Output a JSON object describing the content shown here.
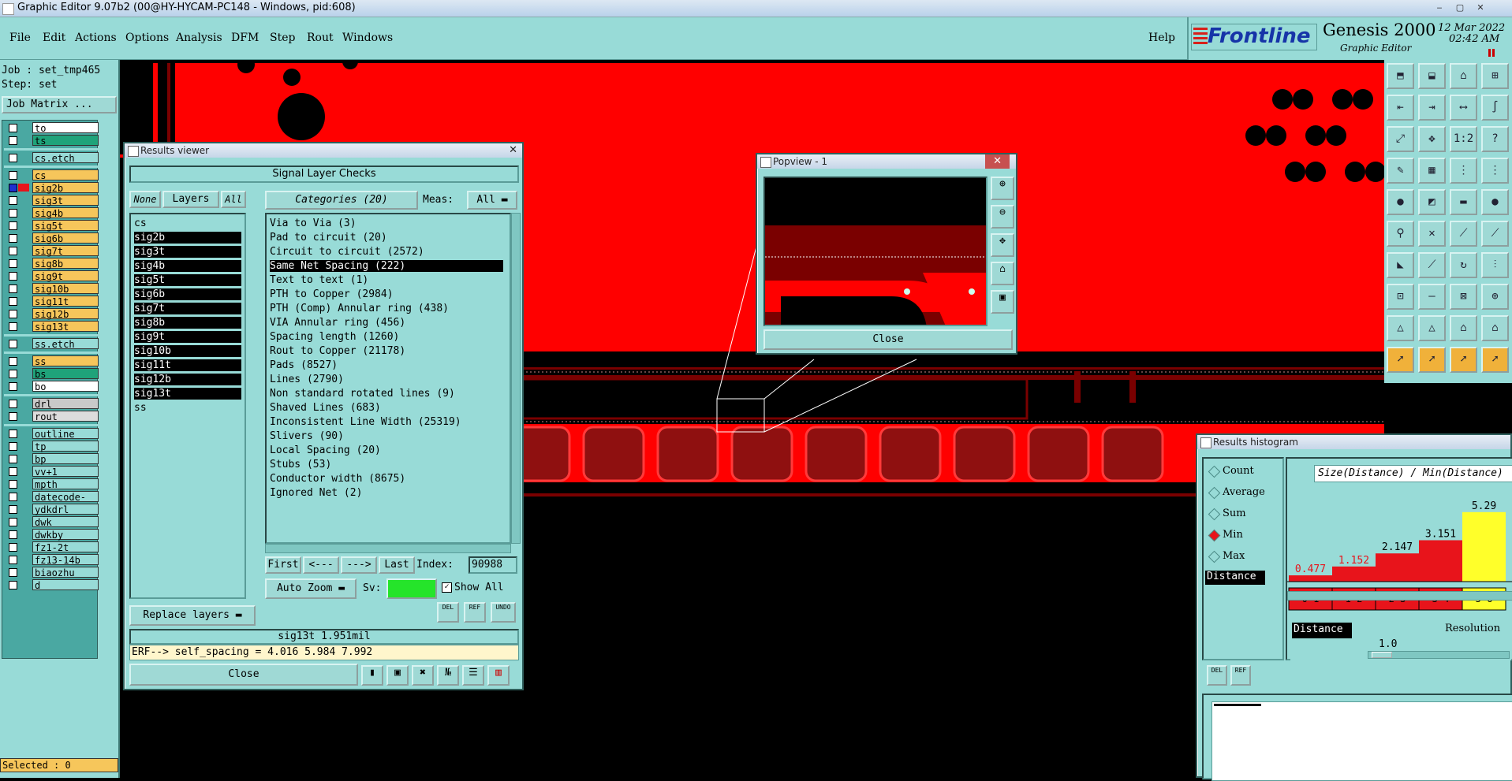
{
  "window": {
    "title": "Graphic Editor 9.07b2 (00@HY-HYCAM-PC148 - Windows, pid:608)",
    "min": "‒",
    "max": "▢",
    "close": "✕"
  },
  "menu": [
    "File",
    "Edit",
    "Actions",
    "Options",
    "Analysis",
    "DFM",
    "Step",
    "Rout",
    "Windows"
  ],
  "help": "Help",
  "brand": {
    "logo": "Frontline",
    "product": "Genesis 2000",
    "subtitle": "Graphic Editor",
    "date": "12 Mar 2022",
    "time": "02:42 AM"
  },
  "left": {
    "job": "Job : set_tmp465",
    "step": "Step: set",
    "job_matrix": "Job Matrix ...",
    "selected": "Selected : 0",
    "layers": [
      {
        "name": "to",
        "color": "#ffffff"
      },
      {
        "name": "ts",
        "color": "#1fa37a"
      },
      {
        "sep": true
      },
      {
        "name": "cs.etch",
        "color": "#98dbd7"
      },
      {
        "sep": true
      },
      {
        "name": "cs",
        "color": "#f6c65b"
      },
      {
        "name": "sig2b",
        "color": "#f6c65b",
        "active": true
      },
      {
        "name": "sig3t",
        "color": "#f6c65b"
      },
      {
        "name": "sig4b",
        "color": "#f6c65b"
      },
      {
        "name": "sig5t",
        "color": "#f6c65b"
      },
      {
        "name": "sig6b",
        "color": "#f6c65b"
      },
      {
        "name": "sig7t",
        "color": "#f6c65b"
      },
      {
        "name": "sig8b",
        "color": "#f6c65b"
      },
      {
        "name": "sig9t",
        "color": "#f6c65b"
      },
      {
        "name": "sig10b",
        "color": "#f6c65b"
      },
      {
        "name": "sig11t",
        "color": "#f6c65b"
      },
      {
        "name": "sig12b",
        "color": "#f6c65b"
      },
      {
        "name": "sig13t",
        "color": "#f6c65b"
      },
      {
        "sep": true
      },
      {
        "name": "ss.etch",
        "color": "#98dbd7"
      },
      {
        "sep": true
      },
      {
        "name": "ss",
        "color": "#f6c65b"
      },
      {
        "name": "bs",
        "color": "#1fa37a"
      },
      {
        "name": "bo",
        "color": "#ffffff"
      },
      {
        "sep": true
      },
      {
        "name": "drl",
        "color": "#c9c9c9"
      },
      {
        "name": "rout",
        "color": "#dcdcdc"
      },
      {
        "sep": true
      },
      {
        "name": "outline",
        "color": "#98dbd7"
      },
      {
        "name": "tp",
        "color": "#98dbd7"
      },
      {
        "name": "bp",
        "color": "#98dbd7"
      },
      {
        "name": "vv+1",
        "color": "#98dbd7"
      },
      {
        "name": "mpth",
        "color": "#98dbd7"
      },
      {
        "name": "datecode-pbe",
        "color": "#98dbd7"
      },
      {
        "name": "ydkdrl",
        "color": "#98dbd7"
      },
      {
        "name": "dwk",
        "color": "#98dbd7"
      },
      {
        "name": "dwkby",
        "color": "#98dbd7"
      },
      {
        "name": "fz1-2t",
        "color": "#98dbd7"
      },
      {
        "name": "fz13-14b",
        "color": "#98dbd7"
      },
      {
        "name": "biaozhu",
        "color": "#98dbd7"
      },
      {
        "name": "d",
        "color": "#98dbd7"
      }
    ]
  },
  "results_viewer": {
    "title": "Results viewer",
    "header": "Signal Layer Checks",
    "none": "None",
    "layers": "Layers",
    "all": "All",
    "categories_btn": "Categories (20)",
    "meas_label": "Meas:",
    "meas_value": "All",
    "layer_list": [
      "cs",
      "sig2b",
      "sig3t",
      "sig4b",
      "sig5t",
      "sig6b",
      "sig7t",
      "sig8b",
      "sig9t",
      "sig10b",
      "sig11t",
      "sig12b",
      "sig13t",
      "ss"
    ],
    "categories": [
      "Via to Via (3)",
      "Pad to circuit (20)",
      "Circuit to circuit (2572)",
      "Same Net Spacing (222)",
      "Text to text (1)",
      "PTH to Copper (2984)",
      "PTH (Comp) Annular ring (438)",
      "VIA Annular ring (456)",
      "Spacing length (1260)",
      "Rout to Copper (21178)",
      "Pads (8527)",
      "Lines (2790)",
      "Non standard rotated lines (9)",
      "Shaved Lines (683)",
      "Inconsistent Line Width (25319)",
      "Slivers (90)",
      "Local Spacing (20)",
      "Stubs (53)",
      "Conductor width (8675)",
      "Ignored Net (2)"
    ],
    "selected_category": "Same Net Spacing (222)",
    "nav": {
      "first": "First",
      "prev": "<---",
      "next": "--->",
      "last": "Last",
      "index_label": "Index:",
      "index_value": "90988"
    },
    "auto_zoom": "Auto Zoom",
    "sv": "Sv:",
    "show_all": "Show All",
    "replace_layers": "Replace layers",
    "del": "DEL",
    "ref": "REF",
    "undo": "UNDO",
    "status": "sig13t 1.951mil",
    "erf": "ERF--> self_spacing = 4.016 5.984 7.992",
    "close": "Close"
  },
  "popview": {
    "title": "Popview - 1",
    "close": "Close"
  },
  "histogram": {
    "title": "Results histogram",
    "options": [
      "Count",
      "Average",
      "Sum",
      "Min",
      "Max"
    ],
    "selected_option": "Min",
    "measure": "Distance",
    "header": "Size(Distance) / Min(Distance)",
    "resolution_label": "Resolution",
    "resolution_value": "1.0",
    "measure2": "Distance",
    "del": "DEL",
    "ref": "REF"
  },
  "chart_data": {
    "type": "bar",
    "categories": [
      "0-1",
      "1-2",
      "2-3",
      "3-4",
      "5-6"
    ],
    "values": [
      0.477,
      1.152,
      2.147,
      3.151,
      5.29
    ],
    "colors": [
      "#e8141b",
      "#e8141b",
      "#e8141b",
      "#e8141b",
      "#ffff2a"
    ],
    "title": "Size(Distance) / Min(Distance)",
    "xlabel": "",
    "ylabel": ""
  }
}
